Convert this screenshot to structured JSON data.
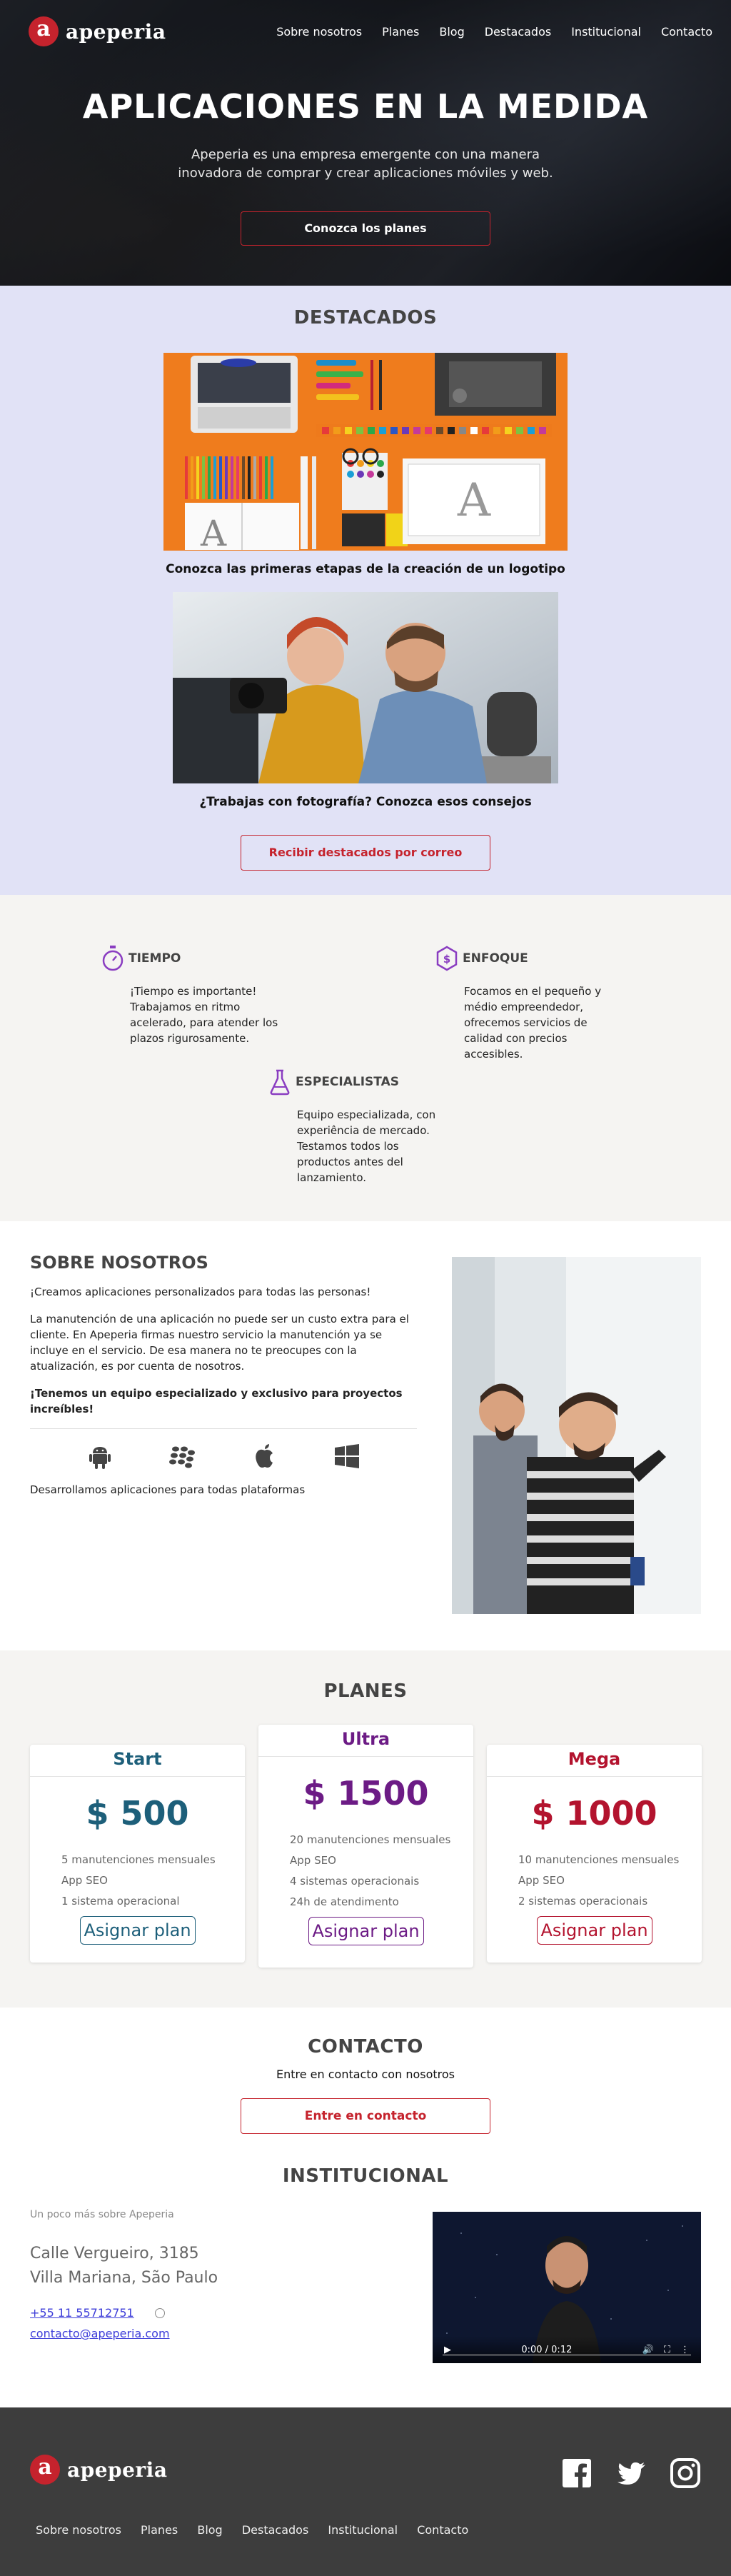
{
  "brand": {
    "logo_letter": "a",
    "name": "apeperia",
    "accent": "#c5232d"
  },
  "nav": {
    "items": [
      "Sobre nosotros",
      "Planes",
      "Blog",
      "Destacados",
      "Institucional",
      "Contacto"
    ]
  },
  "hero": {
    "title": "APLICACIONES EN LA MEDIDA",
    "subtitle": "Apeperia es una empresa emergente con una manera inovadora de comprar y crear aplicaciones móviles y web.",
    "button": "Conozca los planes"
  },
  "destacados": {
    "title": "DESTACADOS",
    "items": [
      {
        "caption": "Conozca las primeras etapas de la creación de un logotipo"
      },
      {
        "caption": "¿Trabajas con fotografía? Conozca esos consejos"
      }
    ],
    "button": "Recibir destacados por correo"
  },
  "services": [
    {
      "icon": "stopwatch-icon",
      "title": "TIEMPO",
      "text": "¡Tiempo es importante! Trabajamos en ritmo acelerado, para atender los plazos rigurosamente."
    },
    {
      "icon": "dollar-hex-icon",
      "title": "ENFOQUE",
      "text": "Focamos en el pequeño y médio empreendedor, ofrecemos servicios de calidad con precios accesibles."
    },
    {
      "icon": "flask-icon",
      "title": "ESPECIALISTAS",
      "text": "Equipo especializada, con experiência de mercado. Testamos todos los productos antes del lanzamiento."
    }
  ],
  "sobre": {
    "title": "SOBRE NOSOTROS",
    "p1": "¡Creamos aplicaciones personalizados para todas las personas!",
    "p2": "La manutención de una aplicación no puede ser un custo extra para el cliente. En Apeperia firmas nuestro servicio la manutención ya se incluye en el servicio. De esa manera no te preocupes con la atualización, es por cuenta de nosotros.",
    "p3": "¡Tenemos un equipo especializado y exclusivo para proyectos increíbles!",
    "platform_icons": [
      "android-icon",
      "blackberry-icon",
      "apple-icon",
      "windows-icon"
    ],
    "platforms_text": "Desarrollamos aplicaciones para todas plataformas"
  },
  "planes": {
    "title": "PLANES",
    "plans": [
      {
        "name": "Start",
        "price": "$ 500",
        "color": "#1d5f7a",
        "features": [
          "5 manutenciones mensuales",
          "App SEO",
          "1 sistema operacional"
        ],
        "button": "Asignar plan"
      },
      {
        "name": "Ultra",
        "price": "$ 1500",
        "color": "#6c1b85",
        "features": [
          "20 manutenciones mensuales",
          "App SEO",
          "4 sistemas operacionais",
          "24h de atendimento"
        ],
        "button": "Asignar plan"
      },
      {
        "name": "Mega",
        "price": "$ 1000",
        "color": "#b3132e",
        "features": [
          "10 manutenciones mensuales",
          "App SEO",
          "2 sistemas operacionais"
        ],
        "button": "Asignar plan"
      }
    ]
  },
  "contacto": {
    "title": "CONTACTO",
    "subtitle": "Entre en contacto con nosotros",
    "button": "Entre en contacto"
  },
  "institucional": {
    "title": "INSTITUCIONAL",
    "small": "Un poco más sobre Apeperia",
    "address_line1": "Calle Vergueiro, 3185",
    "address_line2": "Villa Mariana, São Paulo",
    "phone": "+55 11 55712751",
    "email": "contacto@apeperia.com",
    "video_time": "0:00 / 0:12"
  },
  "footer": {
    "social": [
      "facebook-icon",
      "twitter-icon",
      "instagram-icon"
    ],
    "nav": [
      "Sobre nosotros",
      "Planes",
      "Blog",
      "Destacados",
      "Institucional",
      "Contacto"
    ]
  }
}
